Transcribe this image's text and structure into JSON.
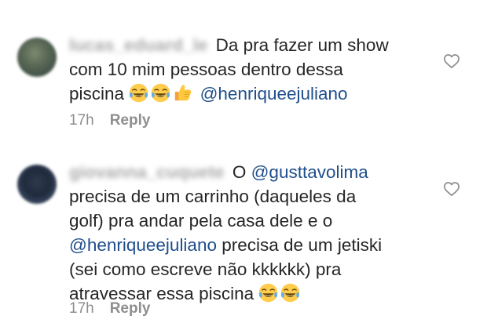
{
  "comments": [
    {
      "username": "lucas_eduard_le",
      "text_parts": {
        "line1": "Da pra fazer um show",
        "line2": "com 10 mim pessoas dentro dessa",
        "line3": "piscina"
      },
      "emojis": [
        "face-with-tears-of-joy",
        "face-with-tears-of-joy",
        "thumbs-up"
      ],
      "mention": "@henriqueejuliano",
      "time": "17h",
      "reply_label": "Reply",
      "liked": false
    },
    {
      "username": "giovanna_cuquete",
      "text_parts": {
        "intro": "O",
        "mention1": "@gusttavolima",
        "line2": "precisa de um carrinho (daqueles da",
        "line3": "golf) pra andar pela casa dele e o",
        "mention2": "@henriqueejuliano",
        "line4_rest": "precisa de um jetiski",
        "line5": "(sei como escreve não kkkkkk) pra",
        "line6": "atravessar essa piscina"
      },
      "emojis": [
        "face-with-tears-of-joy",
        "face-with-tears-of-joy"
      ],
      "time": "17h",
      "reply_label": "Reply",
      "liked": false
    }
  ],
  "colors": {
    "text": "#262626",
    "mention": "#1f4e8c",
    "meta": "#8e8e8e",
    "background": "#ffffff"
  },
  "icons": {
    "like": "heart-outline-icon",
    "emoji_laugh": "face-with-tears-of-joy",
    "emoji_thumb": "thumbs-up"
  }
}
